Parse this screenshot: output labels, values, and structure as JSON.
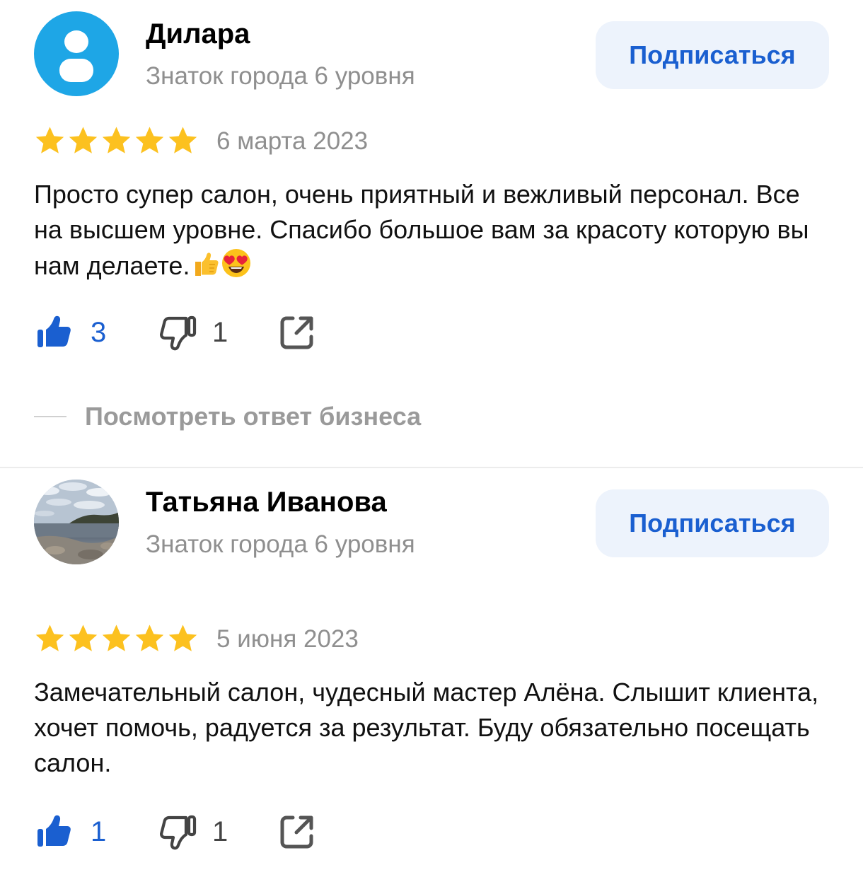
{
  "colors": {
    "accent": "#1a5fd0",
    "star": "#fcc11f",
    "avatar_default": "#1ea6e6",
    "subscribe_bg": "#edf3fc",
    "muted_text": "#8f8f8f"
  },
  "reviews": [
    {
      "author": {
        "name": "Дилара",
        "level": "Знаток города 6 уровня",
        "avatar": "default-person-icon"
      },
      "subscribe_label": "Подписаться",
      "rating": 5,
      "date": "6 марта 2023",
      "text": "Просто супер салон, очень приятный и вежливый персонал. Все на высшем уровне. Спасибо большое вам за красоту которую вы нам делаете.",
      "emojis": [
        "thumbs-up-emoji",
        "heart-eyes-emoji"
      ],
      "likes": "3",
      "dislikes": "1",
      "business_reply_label": "Посмотреть ответ бизнеса"
    },
    {
      "author": {
        "name": "Татьяна Иванова",
        "level": "Знаток города 6 уровня",
        "avatar": "seascape-photo"
      },
      "subscribe_label": "Подписаться",
      "rating": 5,
      "date": "5 июня 2023",
      "text": "Замечательный салон, чудесный мастер Алёна. Слышит клиента, хочет помочь, радуется за результат. Буду обязательно  посещать салон.",
      "likes": "1",
      "dislikes": "1"
    }
  ]
}
